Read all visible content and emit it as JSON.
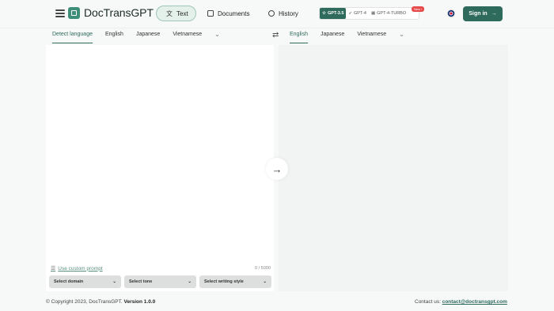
{
  "header": {
    "logo_text": "DocTransGPT",
    "nav": {
      "text": "Text",
      "documents": "Documents",
      "history": "History"
    },
    "models": {
      "gpt35": "GPT-3.5",
      "gpt4": "GPT-4",
      "gpt4turbo": "GPT-4-TURBO",
      "new_badge": "New !"
    },
    "sign_in": "Sign in"
  },
  "source": {
    "tabs": [
      "Detect language",
      "English",
      "Japanese",
      "Vietnamese"
    ],
    "custom_prompt": "Use custom prompt",
    "char_count": "0 / 5000",
    "selects": {
      "domain": "Select domain",
      "tone": "Select tone",
      "style": "Select writing style"
    }
  },
  "target": {
    "tabs": [
      "English",
      "Japanese",
      "Vietnamese"
    ]
  },
  "footer": {
    "copyright": "© Copyright 2023, DocTransGPT.",
    "version": "Version 1.0.0",
    "contact_label": "Contact us:",
    "contact_email": "contact@doctransgpt.com"
  },
  "colors": {
    "accent": "#2e6b5c",
    "accent_light": "#e4f1eb",
    "badge_red": "#e64a4a"
  }
}
